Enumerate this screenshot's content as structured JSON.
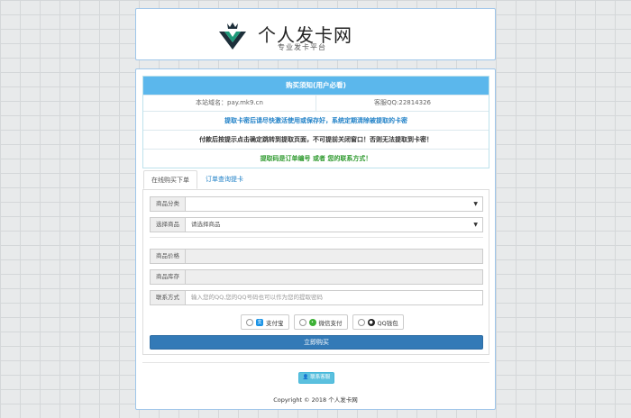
{
  "header": {
    "title": "个人发卡网",
    "subtitle": "专业发卡平台"
  },
  "notice": {
    "heading": "购买须知(用户必看)",
    "site_domain": "本站域名：pay.mk9.cn",
    "support_qq": "客服QQ:22814326",
    "line1": "提取卡密后请尽快激活使用或保存好，系统定期清除被提取的卡密",
    "line2": "付款后按提示点击确定跳转到提取页面，不可提前关闭窗口！否则无法提取到卡密！",
    "line3": "提取码是订单编号 或者 您的联系方式！"
  },
  "tabs": [
    {
      "label": "在线购买下单",
      "active": true
    },
    {
      "label": "订单查询提卡",
      "active": false
    }
  ],
  "form": {
    "category_label": "商品分类",
    "category_value": "",
    "product_label": "选择商品",
    "product_value": "请选择商品",
    "price_label": "商品价格",
    "price_value": "",
    "stock_label": "商品库存",
    "stock_value": "",
    "contact_label": "联系方式",
    "contact_placeholder": "输入您的QQ,您的QQ号码也可以作为您的提取密码"
  },
  "payments": [
    {
      "name": "alipay",
      "label": "支付宝",
      "icon": "alipay-icon",
      "color": "#1a93e6"
    },
    {
      "name": "wechat",
      "label": "微信支付",
      "icon": "wechat-icon",
      "color": "#3cb035"
    },
    {
      "name": "qq",
      "label": "QQ钱包",
      "icon": "qq-icon",
      "color": "#222222"
    }
  ],
  "buy_button": "立即购买",
  "contact_button": "联系客服",
  "copyright": "Copyright © 2018 个人发卡网",
  "colors": {
    "accent": "#337ab7",
    "notice_header": "#5bb7ec",
    "info_button": "#5bc0de"
  }
}
